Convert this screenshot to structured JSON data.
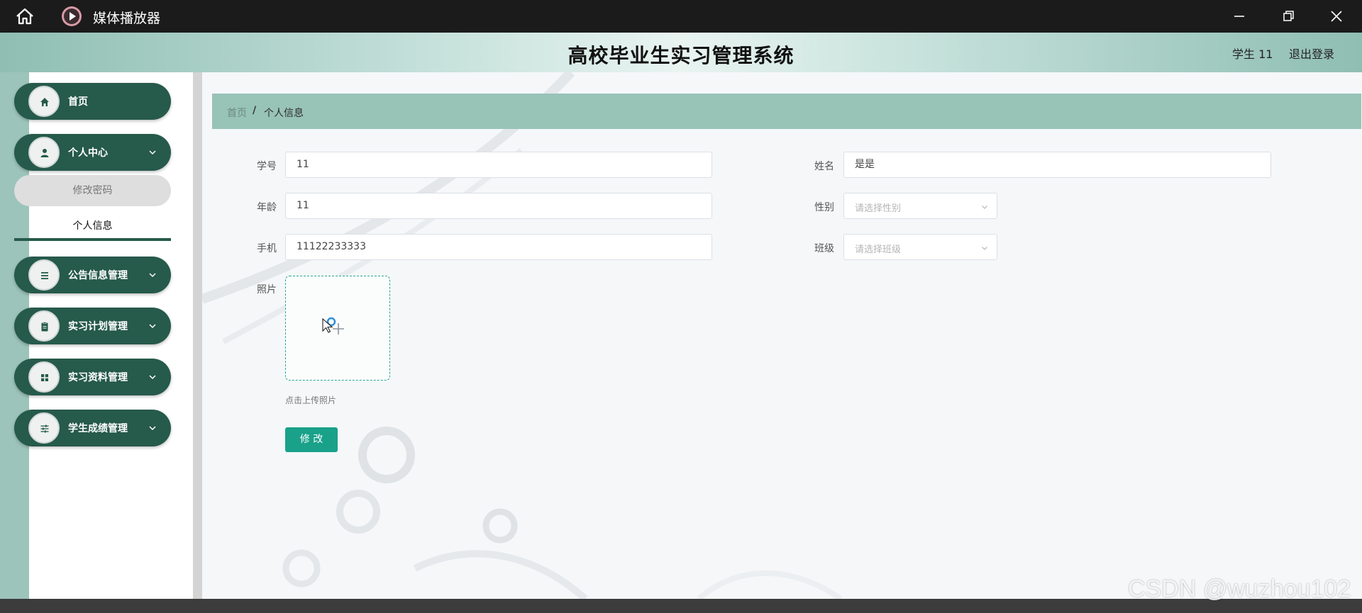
{
  "window": {
    "title": "媒体播放器"
  },
  "header": {
    "title": "高校毕业生实习管理系统",
    "user": "学生 11",
    "logout": "退出登录"
  },
  "sidebar": {
    "items": [
      {
        "label": "首页",
        "icon": "home-icon"
      },
      {
        "label": "个人中心",
        "icon": "user-icon"
      },
      {
        "label": "公告信息管理",
        "icon": "list-icon"
      },
      {
        "label": "实习计划管理",
        "icon": "clipboard-icon"
      },
      {
        "label": "实习资料管理",
        "icon": "grid-icon"
      },
      {
        "label": "学生成绩管理",
        "icon": "sliders-icon"
      }
    ],
    "submenu": {
      "change_password": "修改密码",
      "personal_info": "个人信息"
    }
  },
  "breadcrumb": {
    "home": "首页",
    "separator": "/",
    "current": "个人信息"
  },
  "form": {
    "student_id": {
      "label": "学号",
      "value": "11"
    },
    "name": {
      "label": "姓名",
      "value": "是是"
    },
    "age": {
      "label": "年龄",
      "value": "11"
    },
    "gender": {
      "label": "性别",
      "placeholder": "请选择性别"
    },
    "phone": {
      "label": "手机",
      "value": "11122233333"
    },
    "class": {
      "label": "班级",
      "placeholder": "请选择班级"
    },
    "photo": {
      "label": "照片",
      "hint": "点击上传照片"
    },
    "submit": "修 改"
  },
  "watermark": "CSDN @wuzhou102",
  "colors": {
    "accent": "#19a18a",
    "sidebar_pill": "#265a4b",
    "breadcrumb_bar": "#98c3b7"
  }
}
